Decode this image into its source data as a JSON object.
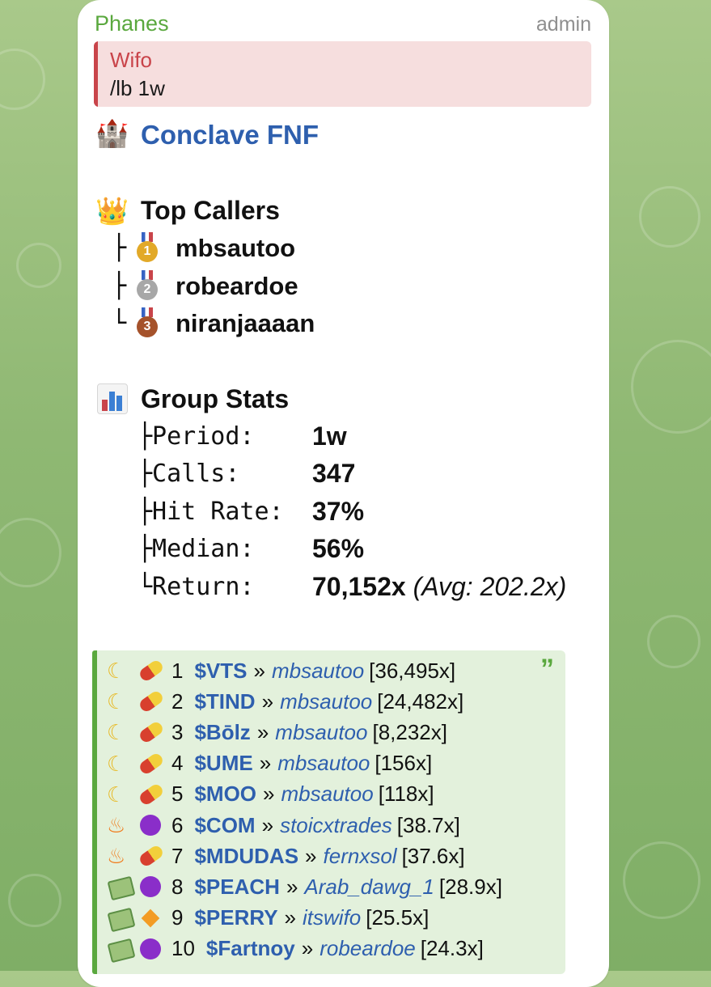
{
  "message": {
    "sender": "Phanes",
    "role_badge": "admin",
    "reply": {
      "name": "Wifo",
      "text": "/lb 1w"
    },
    "group": {
      "emoji": "🏰",
      "name": "Conclave FNF"
    },
    "top_callers": {
      "emoji": "👑",
      "title": "Top Callers",
      "items": [
        {
          "branch": "├",
          "medal": "1",
          "name": "mbsautoo"
        },
        {
          "branch": "├",
          "medal": "2",
          "name": "robeardoe"
        },
        {
          "branch": "└",
          "medal": "3",
          "name": "niranjaaaan"
        }
      ]
    },
    "group_stats": {
      "emoji": "📊",
      "title": "Group Stats",
      "rows": [
        {
          "label": "├Period:",
          "value": "1w"
        },
        {
          "label": "├Calls:",
          "value": "347"
        },
        {
          "label": "├Hit Rate:",
          "value": "37%"
        },
        {
          "label": "├Median:",
          "value": "56%"
        },
        {
          "label": "└Return:",
          "value": "70,152x",
          "extra": "(Avg: 202.2x)"
        }
      ]
    },
    "leaderboard": [
      {
        "icon1": "moon",
        "icon2": "pill",
        "rank": "1",
        "ticker": "$VTS",
        "sep": "»",
        "caller": "mbsautoo",
        "multiple": "[36,495x]"
      },
      {
        "icon1": "moon",
        "icon2": "pill",
        "rank": "2",
        "ticker": "$TIND",
        "sep": "»",
        "caller": "mbsautoo",
        "multiple": "[24,482x]"
      },
      {
        "icon1": "moon",
        "icon2": "pill",
        "rank": "3",
        "ticker": "$Bōlz",
        "sep": "»",
        "caller": "mbsautoo",
        "multiple": "[8,232x]"
      },
      {
        "icon1": "moon",
        "icon2": "pill",
        "rank": "4",
        "ticker": "$UME",
        "sep": "»",
        "caller": "mbsautoo",
        "multiple": "[156x]"
      },
      {
        "icon1": "moon",
        "icon2": "pill",
        "rank": "5",
        "ticker": "$MOO",
        "sep": "»",
        "caller": "mbsautoo",
        "multiple": "[118x]"
      },
      {
        "icon1": "fire",
        "icon2": "purple-circle",
        "rank": "6",
        "ticker": "$COM",
        "sep": "»",
        "caller": "stoicxtrades",
        "multiple": "[38.7x]"
      },
      {
        "icon1": "fire",
        "icon2": "pill",
        "rank": "7",
        "ticker": "$MDUDAS",
        "sep": "»",
        "caller": "fernxsol",
        "multiple": "[37.6x]"
      },
      {
        "icon1": "money-wings",
        "icon2": "purple-circle",
        "rank": "8",
        "ticker": "$PEACH",
        "sep": "»",
        "caller": "Arab_dawg_1",
        "multiple": "[28.9x]"
      },
      {
        "icon1": "money-wings",
        "icon2": "orange-diamond",
        "rank": "9",
        "ticker": "$PERRY",
        "sep": "»",
        "caller": "itswifo",
        "multiple": "[25.5x]"
      },
      {
        "icon1": "money-wings",
        "icon2": "purple-circle",
        "rank": "10",
        "ticker": "$Fartnoy",
        "sep": "»",
        "caller": "robeardoe",
        "multiple": "[24.3x]"
      }
    ],
    "colors": {
      "sender": "#5aa83e",
      "link": "#2e5fae",
      "reply_accent": "#c9444a",
      "quote_accent": "#5aa83e",
      "chat_background": "#8fb873"
    }
  }
}
